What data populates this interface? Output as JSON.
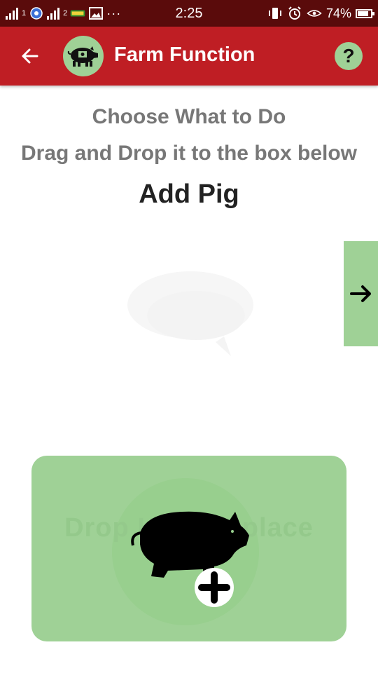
{
  "status_bar": {
    "time": "2:25",
    "battery_percent": "74%",
    "sim1_label": "1",
    "sim2_label": "2",
    "battery_level": 0.74
  },
  "app_bar": {
    "title": "Farm Function",
    "help_label": "?"
  },
  "content": {
    "instruction_line1": "Choose What to Do",
    "instruction_line2": "Drag and Drop it to the box below",
    "current_action": "Add Pig"
  },
  "drop_box": {
    "hint_text": "Drop Here to place",
    "icon": "pig-add-icon"
  },
  "colors": {
    "app_bar": "#bf1e24",
    "status_bar": "#5a0b0b",
    "accent_green": "#9fd196"
  }
}
